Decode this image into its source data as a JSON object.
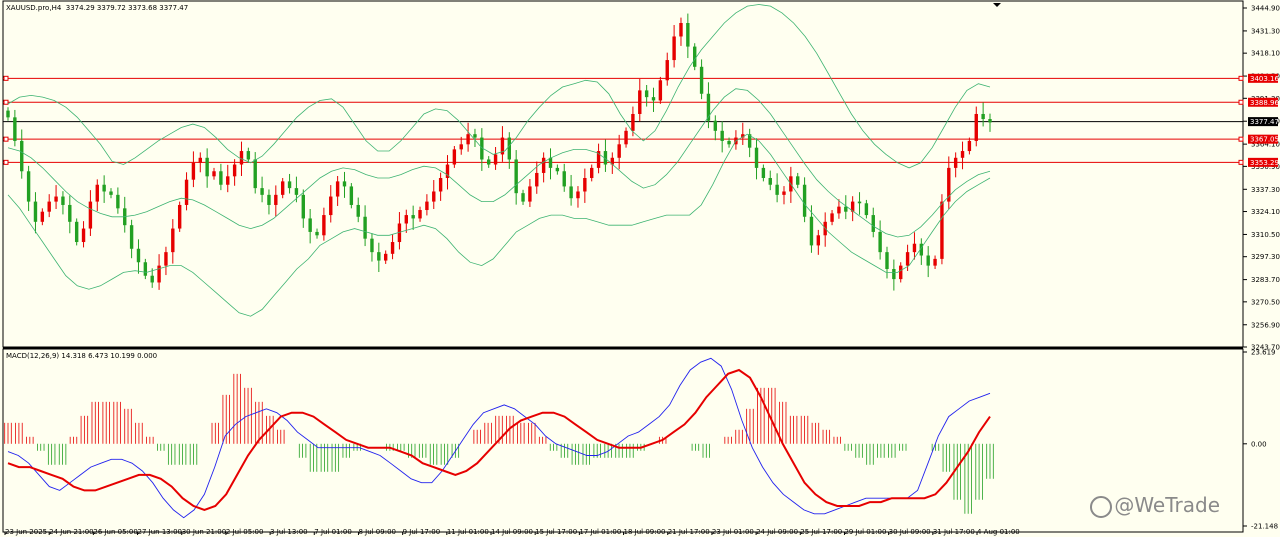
{
  "main_header": {
    "symbol": "XAUUSD.pro,H4",
    "ohlc": "3374.29 3379.72 3373.68 3377.47"
  },
  "macd_header": "MACD(12,26,9) 14.318 6.473 10.199 0.000",
  "watermark": "@WeTrade",
  "colors": {
    "background": "#fffff0",
    "bull": "#e60000",
    "bear": "#22a022",
    "bands": "#3cb371",
    "level_line": "#e60000",
    "price_line": "#000000",
    "macd_line": "#2222ee",
    "signal_line": "#e60000"
  },
  "chart_data": [
    {
      "type": "candlestick",
      "title": "XAUUSD.pro,H4",
      "y_ticks": [
        "3444.90",
        "3431.30",
        "3418.10",
        "3404.50",
        "3391.30",
        "3377.70",
        "3364.10",
        "3350.90",
        "3337.30",
        "3324.10",
        "3310.50",
        "3297.30",
        "3283.70",
        "3270.50",
        "3256.90",
        "3243.70"
      ],
      "ylim": [
        3243.7,
        3444.9
      ],
      "x_tick_labels": [
        "23 Jun 2025",
        "24 Jun 21:00",
        "26 Jun 05:00",
        "27 Jun 13:00",
        "30 Jun 21:00",
        "2 Jul 05:00",
        "3 Jul 13:00",
        "7 Jul 01:00",
        "8 Jul 09:00",
        "9 Jul 17:00",
        "11 Jul 01:00",
        "14 Jul 09:00",
        "15 Jul 17:00",
        "17 Jul 01:00",
        "18 Jul 09:00",
        "21 Jul 17:00",
        "23 Jul 01:00",
        "24 Jul 09:00",
        "25 Jul 17:00",
        "29 Jul 01:00",
        "30 Jul 09:00",
        "31 Jul 17:00",
        "4 Aug 01:00"
      ],
      "horizontal_levels": [
        {
          "price": 3403.16,
          "label": "3403.16"
        },
        {
          "price": 3388.96,
          "label": "3388.96"
        },
        {
          "price": 3367.05,
          "label": "3367.05"
        },
        {
          "price": 3353.29,
          "label": "3353.29"
        }
      ],
      "current_price": {
        "price": 3377.47,
        "label": "3377.47"
      },
      "close": [
        3380,
        3366,
        3348,
        3330,
        3318,
        3324,
        3330,
        3333,
        3328,
        3318,
        3306,
        3314,
        3330,
        3340,
        3336,
        3334,
        3326,
        3316,
        3302,
        3294,
        3286,
        3282,
        3292,
        3300,
        3314,
        3328,
        3343,
        3353,
        3356,
        3345,
        3348,
        3340,
        3345,
        3352,
        3360,
        3355,
        3338,
        3334,
        3328,
        3334,
        3342,
        3338,
        3334,
        3320,
        3312,
        3310,
        3322,
        3333,
        3342,
        3339,
        3328,
        3321,
        3308,
        3300,
        3295,
        3299,
        3306,
        3317,
        3322,
        3320,
        3325,
        3330,
        3336,
        3344,
        3352,
        3361,
        3364,
        3370,
        3368,
        3355,
        3352,
        3358,
        3368,
        3355,
        3335,
        3330,
        3339,
        3347,
        3356,
        3350,
        3348,
        3339,
        3332,
        3336,
        3344,
        3350,
        3360,
        3352,
        3356,
        3364,
        3372,
        3382,
        3396,
        3392,
        3390,
        3402,
        3414,
        3428,
        3436,
        3422,
        3410,
        3394,
        3378,
        3372,
        3366,
        3364,
        3368,
        3370,
        3362,
        3350,
        3344,
        3340,
        3334,
        3336,
        3345,
        3340,
        3321,
        3304,
        3310,
        3318,
        3323,
        3327,
        3324,
        3330,
        3329,
        3322,
        3312,
        3300,
        3290,
        3284,
        3292,
        3300,
        3305,
        3298,
        3292,
        3296,
        3330,
        3350,
        3356,
        3360,
        3366,
        3382,
        3379,
        3377
      ],
      "upper_band": [
        3388,
        3392,
        3393,
        3392,
        3390,
        3386,
        3380,
        3372,
        3364,
        3354,
        3352,
        3356,
        3361,
        3366,
        3370,
        3374,
        3376,
        3374,
        3368,
        3361,
        3356,
        3353,
        3357,
        3364,
        3372,
        3380,
        3386,
        3390,
        3391,
        3386,
        3376,
        3366,
        3360,
        3360,
        3366,
        3374,
        3382,
        3385,
        3384,
        3378,
        3370,
        3362,
        3358,
        3360,
        3368,
        3378,
        3386,
        3393,
        3398,
        3400,
        3402,
        3401,
        3394,
        3382,
        3372,
        3366,
        3372,
        3384,
        3398,
        3410,
        3420,
        3428,
        3436,
        3442,
        3446,
        3447,
        3446,
        3442,
        3436,
        3428,
        3418,
        3406,
        3394,
        3382,
        3372,
        3364,
        3358,
        3353,
        3350,
        3353,
        3362,
        3374,
        3386,
        3396,
        3400,
        3398
      ],
      "middle_band": [
        3362,
        3360,
        3356,
        3350,
        3343,
        3336,
        3330,
        3326,
        3323,
        3321,
        3321,
        3322,
        3324,
        3327,
        3330,
        3332,
        3331,
        3328,
        3324,
        3320,
        3316,
        3314,
        3316,
        3320,
        3326,
        3332,
        3338,
        3344,
        3348,
        3350,
        3349,
        3346,
        3344,
        3344,
        3346,
        3349,
        3351,
        3350,
        3346,
        3340,
        3334,
        3330,
        3330,
        3334,
        3340,
        3346,
        3352,
        3356,
        3359,
        3361,
        3361,
        3359,
        3354,
        3348,
        3342,
        3338,
        3340,
        3346,
        3354,
        3364,
        3374,
        3384,
        3392,
        3397,
        3396,
        3390,
        3382,
        3372,
        3362,
        3352,
        3343,
        3336,
        3330,
        3325,
        3320,
        3315,
        3311,
        3309,
        3310,
        3315,
        3322,
        3330,
        3337,
        3342,
        3346,
        3348
      ],
      "lower_band": [
        3334,
        3326,
        3316,
        3306,
        3296,
        3286,
        3280,
        3278,
        3280,
        3284,
        3288,
        3289,
        3288,
        3290,
        3292,
        3292,
        3288,
        3282,
        3276,
        3270,
        3264,
        3262,
        3266,
        3274,
        3282,
        3290,
        3296,
        3304,
        3308,
        3312,
        3314,
        3312,
        3310,
        3310,
        3312,
        3314,
        3316,
        3314,
        3308,
        3300,
        3294,
        3292,
        3296,
        3304,
        3312,
        3316,
        3320,
        3322,
        3322,
        3320,
        3320,
        3318,
        3316,
        3316,
        3316,
        3318,
        3320,
        3322,
        3322,
        3322,
        3328,
        3340,
        3354,
        3366,
        3370,
        3366,
        3358,
        3348,
        3338,
        3328,
        3320,
        3312,
        3306,
        3300,
        3296,
        3292,
        3288,
        3288,
        3292,
        3302,
        3312,
        3322,
        3330,
        3336,
        3340,
        3344
      ]
    },
    {
      "type": "macd",
      "title": "MACD(12,26,9) 14.318 6.473 10.199 0.000",
      "y_ticks": [
        "23.619",
        "0.00",
        "-21.148"
      ],
      "ylim": [
        -21.148,
        23.619
      ],
      "macd_line": [
        -2,
        -3,
        -5,
        -8,
        -11,
        -12,
        -10,
        -8,
        -6,
        -5,
        -4,
        -4,
        -5,
        -7,
        -10,
        -14,
        -17,
        -19,
        -17,
        -13,
        -6,
        2,
        5,
        7,
        8,
        9,
        8,
        6,
        3,
        1,
        -1,
        -1,
        -1,
        -1,
        -1,
        -2,
        -3,
        -5,
        -7,
        -9,
        -10,
        -10,
        -7,
        -3,
        1,
        5,
        8,
        9,
        10,
        9,
        7,
        5,
        2,
        0,
        -1,
        -2,
        -3,
        -3,
        -2,
        0,
        2,
        3,
        5,
        7,
        10,
        15,
        19,
        21,
        22,
        20,
        14,
        6,
        -1,
        -6,
        -10,
        -13,
        -15,
        -17,
        -18,
        -18,
        -17,
        -16,
        -15,
        -14,
        -14,
        -14,
        -14,
        -14,
        -12,
        -5,
        2,
        7,
        9,
        11,
        12,
        13
      ],
      "signal_line": [
        -5,
        -6,
        -6,
        -7,
        -8,
        -9,
        -11,
        -12,
        -12,
        -11,
        -10,
        -9,
        -8,
        -8,
        -9,
        -11,
        -14,
        -16,
        -17,
        -16,
        -13,
        -8,
        -3,
        1,
        4,
        7,
        8,
        8,
        7,
        5,
        3,
        1,
        0,
        -1,
        -1,
        -1,
        -2,
        -3,
        -5,
        -6,
        -7,
        -8,
        -7,
        -5,
        -2,
        1,
        4,
        6,
        7,
        8,
        8,
        7,
        5,
        3,
        1,
        0,
        -1,
        -1,
        -1,
        0,
        1,
        3,
        5,
        8,
        12,
        15,
        18,
        19,
        17,
        12,
        6,
        0,
        -5,
        -10,
        -13,
        -15,
        -16,
        -16,
        -16,
        -15,
        -15,
        -14,
        -14,
        -14,
        -14,
        -13,
        -10,
        -6,
        -2,
        3,
        7
      ]
    }
  ]
}
